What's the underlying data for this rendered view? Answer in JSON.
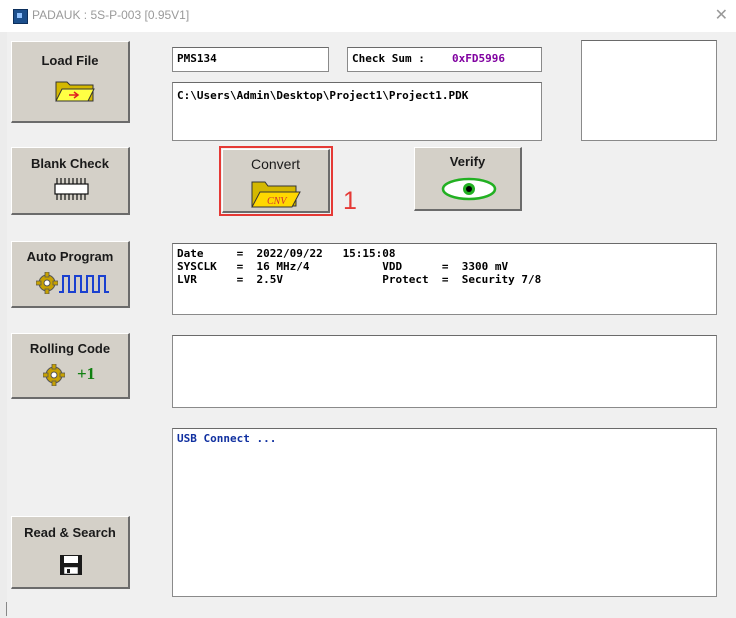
{
  "window": {
    "title": "PADAUK : 5S-P-003 [0.95V1]"
  },
  "buttons": {
    "load_file": "Load File",
    "blank_check": "Blank Check",
    "convert": "Convert",
    "verify": "Verify",
    "auto_program": "Auto Program",
    "rolling_code": "Rolling Code",
    "rolling_increment": "+1",
    "read_search": "Read & Search"
  },
  "ic_name": "PMS134",
  "checksum": {
    "label": "Check Sum : ",
    "value": "0xFD5996"
  },
  "file_path": "C:\\Users\\Admin\\Desktop\\Project1\\Project1.PDK",
  "info_lines": [
    "Date     =  2022/09/22   15:15:08",
    "SYSCLK   =  16 MHz/4           VDD      =  3300 mV",
    "LVR      =  2.5V               Protect  =  Security 7/8"
  ],
  "log_text": "USB Connect ...",
  "annotation": "1",
  "colors": {
    "annotation_red": "#e53935",
    "checksum_purple": "#8000a0",
    "log_blue": "#1030a0",
    "button_face": "#d4d0c8"
  }
}
